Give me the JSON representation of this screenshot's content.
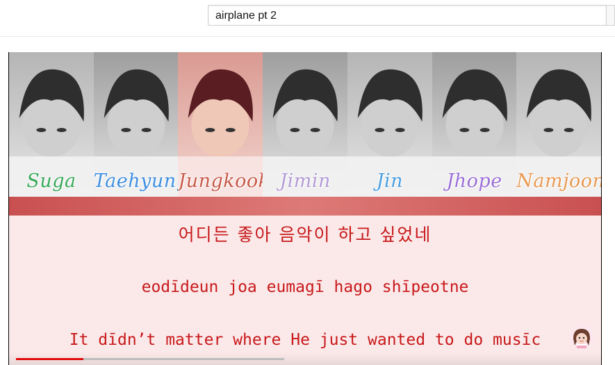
{
  "search": {
    "value": "airplane pt 2",
    "placeholder": ""
  },
  "video": {
    "members": [
      {
        "name": "Suga",
        "color": "#3aa95a"
      },
      {
        "name": "Taehyung",
        "color": "#3f8fe0"
      },
      {
        "name": "Jungkook",
        "color": "#c85a4a"
      },
      {
        "name": "Jimin",
        "color": "#b39ad6"
      },
      {
        "name": "Jin",
        "color": "#4a9fe0"
      },
      {
        "name": "Jhope",
        "color": "#9b6fd6"
      },
      {
        "name": "Namjoon",
        "color": "#e89a52"
      }
    ],
    "highlighted_member": "Jungkook",
    "lyrics": {
      "korean": "어디든 좋아 음악이 하고 싶었네",
      "romanized": "eodīdeun joa eumagī hago shīpeotne",
      "english": "It dīdn’t matter where He just wanted to do musīc"
    },
    "progress_fraction": 0.25,
    "lyric_color": "#c8191b",
    "progress_color": "#e20a0a"
  },
  "icons": {
    "channel_avatar": "avatar-icon"
  }
}
